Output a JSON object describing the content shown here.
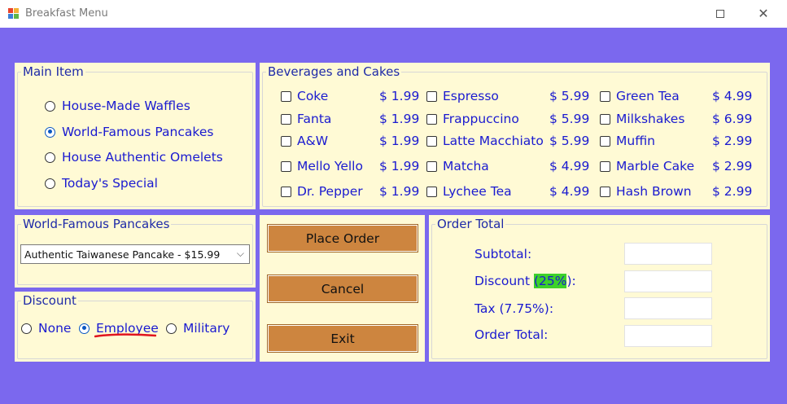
{
  "window": {
    "title": "Breakfast Menu",
    "maximize_icon": "maximize-icon",
    "close_icon": "close-icon",
    "close_glyph": "✕"
  },
  "main_item": {
    "title": "Main Item",
    "options": [
      {
        "label": "House-Made Waffles",
        "checked": false
      },
      {
        "label": "World-Famous Pancakes",
        "checked": true
      },
      {
        "label": "House Authentic Omelets",
        "checked": false
      },
      {
        "label": "Today's Special",
        "checked": false
      }
    ]
  },
  "beverages": {
    "title": "Beverages and Cakes",
    "columns": [
      [
        {
          "name": "Coke",
          "price": "$ 1.99"
        },
        {
          "name": "Fanta",
          "price": "$ 1.99"
        },
        {
          "name": "A&W",
          "price": "$ 1.99"
        },
        {
          "name": "Mello Yello",
          "price": "$ 1.99"
        },
        {
          "name": "Dr. Pepper",
          "price": "$ 1.99"
        }
      ],
      [
        {
          "name": "Espresso",
          "price": "$ 5.99"
        },
        {
          "name": "Frappuccino",
          "price": "$ 5.99"
        },
        {
          "name": "Latte Macchiato",
          "price": "$ 5.99"
        },
        {
          "name": "Matcha",
          "price": "$ 4.99"
        },
        {
          "name": "Lychee Tea",
          "price": "$ 4.99"
        }
      ],
      [
        {
          "name": "Green Tea",
          "price": "$ 4.99"
        },
        {
          "name": "Milkshakes",
          "price": "$ 6.99"
        },
        {
          "name": "Muffin",
          "price": "$ 2.99"
        },
        {
          "name": "Marble Cake",
          "price": "$ 2.99"
        },
        {
          "name": "Hash Brown",
          "price": "$ 2.99"
        }
      ]
    ]
  },
  "pancakes": {
    "title": "World-Famous Pancakes",
    "selected": "Authentic Taiwanese Pancake - $15.99",
    "arrow": "⌵"
  },
  "discount": {
    "title": "Discount",
    "options": [
      {
        "label": "None",
        "checked": false
      },
      {
        "label": "Employee",
        "checked": true
      },
      {
        "label": "Military",
        "checked": false
      }
    ],
    "annotation_color": "#e0141e"
  },
  "actions": {
    "place_order": "Place Order",
    "cancel": "Cancel",
    "exit": "Exit"
  },
  "order_total": {
    "title": "Order Total",
    "subtotal_label": "Subtotal:",
    "discount_prefix": "Discount ",
    "discount_pct": "(25%",
    "discount_suffix": "):",
    "tax_label": "Tax (7.75%):",
    "total_label": "Order Total:",
    "subtotal_value": "",
    "discount_value": "",
    "tax_value": "",
    "total_value": ""
  },
  "colors": {
    "background": "#7b68ee",
    "panel": "#fffad5",
    "button": "#cd853f",
    "text": "#1a1ad0",
    "highlight": "#3dd12a"
  }
}
